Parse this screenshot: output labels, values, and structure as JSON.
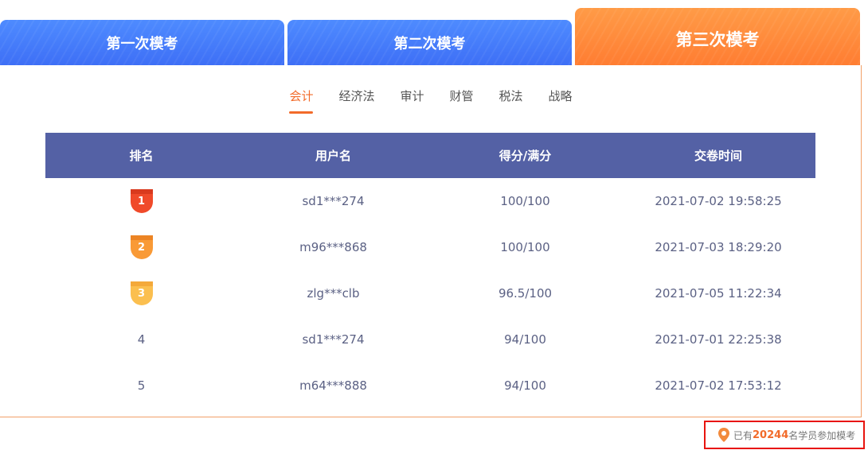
{
  "exam_tabs": [
    {
      "label": "第一次模考"
    },
    {
      "label": "第二次模考"
    },
    {
      "label": "第三次模考"
    }
  ],
  "subjects": [
    {
      "label": "会计"
    },
    {
      "label": "经济法"
    },
    {
      "label": "审计"
    },
    {
      "label": "财管"
    },
    {
      "label": "税法"
    },
    {
      "label": "战略"
    }
  ],
  "table": {
    "headers": {
      "rank": "排名",
      "username": "用户名",
      "score": "得分/满分",
      "time": "交卷时间"
    },
    "rows": [
      {
        "rank": "1",
        "username": "sd1***274",
        "score": "100/100",
        "time": "2021-07-02 19:58:25"
      },
      {
        "rank": "2",
        "username": "m96***868",
        "score": "100/100",
        "time": "2021-07-03 18:29:20"
      },
      {
        "rank": "3",
        "username": "zlg***clb",
        "score": "96.5/100",
        "time": "2021-07-05 11:22:34"
      },
      {
        "rank": "4",
        "username": "sd1***274",
        "score": "94/100",
        "time": "2021-07-01 22:25:38"
      },
      {
        "rank": "5",
        "username": "m64***888",
        "score": "94/100",
        "time": "2021-07-02 17:53:12"
      }
    ]
  },
  "footer": {
    "prefix": "已有",
    "count": "20244",
    "suffix": "名学员参加模考"
  },
  "colors": {
    "blue_tab": "#3e6ff6",
    "orange_tab": "#ff7d32",
    "accent": "#f26b2a",
    "header_bg": "#5461a5",
    "medal_1": "#f04a2a",
    "medal_2": "#f99a36",
    "medal_3": "#fbbf4f"
  },
  "icons": {
    "pin": "location-pin-icon",
    "medal": "rank-medal-icon"
  }
}
